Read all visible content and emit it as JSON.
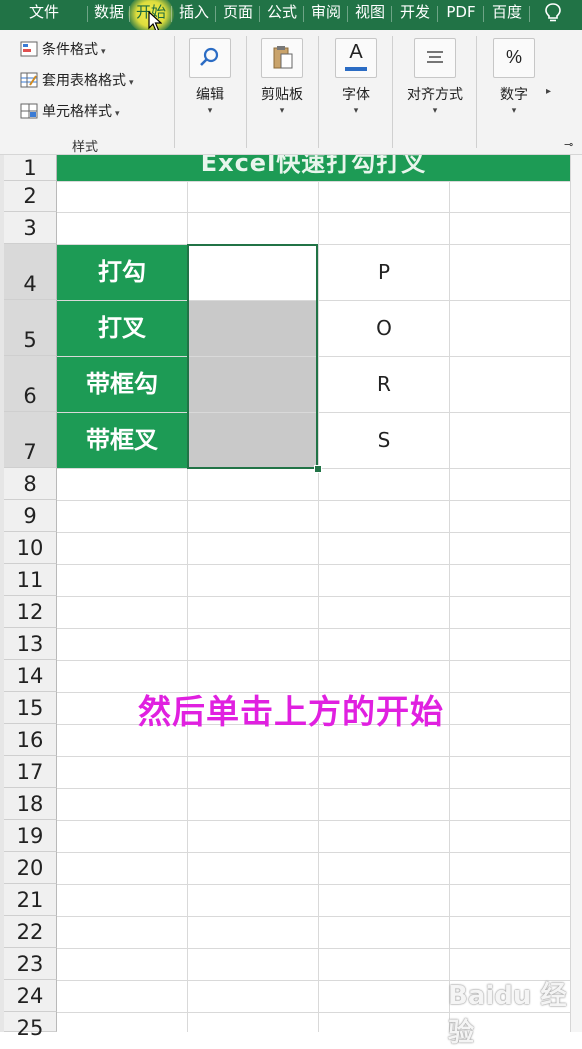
{
  "tabs": [
    {
      "label": "文件",
      "active": false
    },
    {
      "label": "数据",
      "active": false
    },
    {
      "label": "开始",
      "active": true
    },
    {
      "label": "插入",
      "active": false
    },
    {
      "label": "页面",
      "active": false
    },
    {
      "label": "公式",
      "active": false
    },
    {
      "label": "审阅",
      "active": false
    },
    {
      "label": "视图",
      "active": false
    },
    {
      "label": "开发",
      "active": false
    },
    {
      "label": "PDF",
      "active": false
    },
    {
      "label": "百度",
      "active": false
    }
  ],
  "ribbon": {
    "styles_group": {
      "items": [
        "条件格式",
        "套用表格格式",
        "单元格样式"
      ],
      "label": "样式"
    },
    "buttons": [
      {
        "icon": "search-icon",
        "label": "编辑"
      },
      {
        "icon": "clipboard-icon",
        "label": "剪贴板"
      },
      {
        "icon": "font-color-icon",
        "icon_text": "A",
        "label": "字体"
      },
      {
        "icon": "align-icon",
        "label": "对齐方式"
      },
      {
        "icon": "percent-icon",
        "icon_text": "%",
        "label": "数字"
      }
    ]
  },
  "sheet": {
    "title": "Excel快速打勾打叉",
    "row_numbers": [
      "1",
      "2",
      "3",
      "4",
      "5",
      "6",
      "7",
      "8",
      "9",
      "10",
      "11",
      "12",
      "13",
      "14",
      "15",
      "16",
      "17",
      "18",
      "19",
      "20",
      "21",
      "22",
      "23",
      "24",
      "25"
    ],
    "labels": [
      "打勾",
      "打叉",
      "带框勾",
      "带框叉"
    ],
    "letters": [
      "P",
      "O",
      "R",
      "S"
    ],
    "caption": "然后单击上方的开始",
    "watermark": "Baidu 经验"
  },
  "colors": {
    "excel_green": "#217346",
    "label_green": "#1d9b55",
    "caption_magenta": "#e020e0",
    "highlight_yellow": "#fff03c"
  }
}
